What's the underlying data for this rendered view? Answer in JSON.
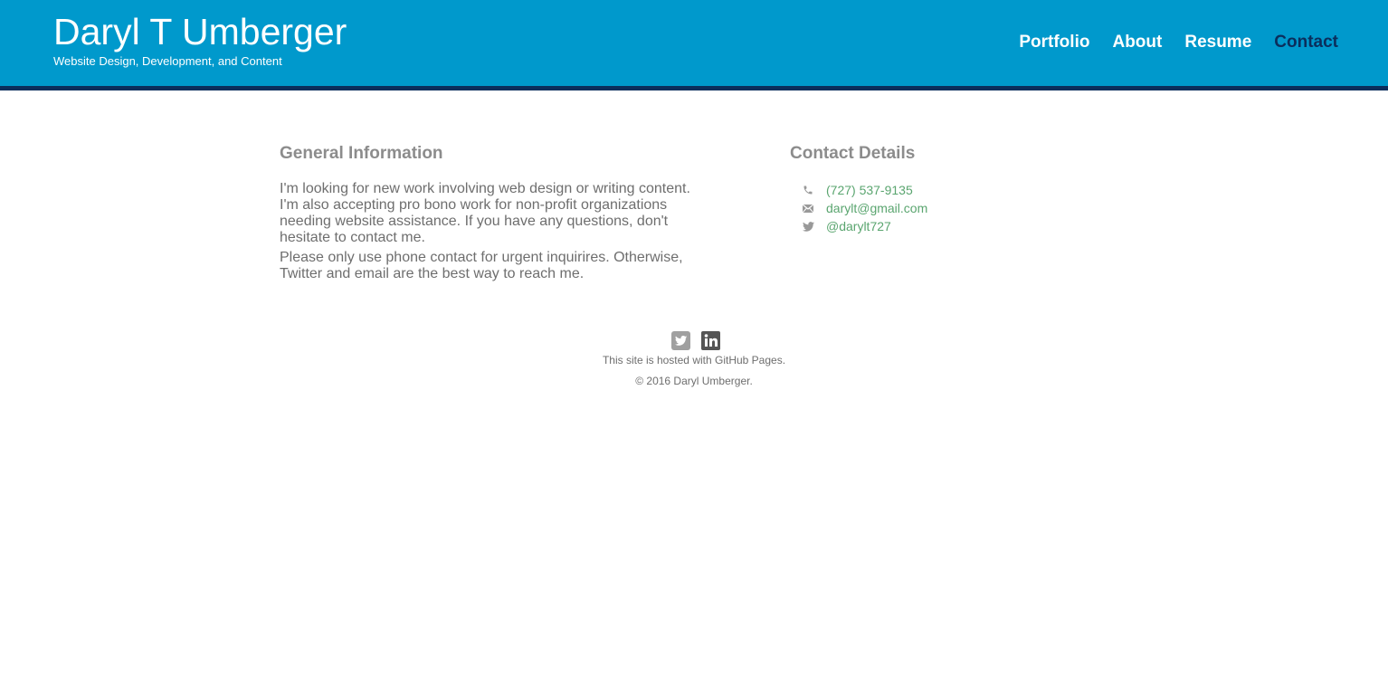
{
  "header": {
    "title": "Daryl T Umberger",
    "tagline": "Website Design, Development, and Content",
    "nav": [
      {
        "label": "Portfolio"
      },
      {
        "label": "About"
      },
      {
        "label": "Resume"
      },
      {
        "label": "Contact",
        "active": true
      }
    ]
  },
  "general": {
    "title": "General Information",
    "paragraphs": [
      "I'm looking for new work involving web design or writing content. I'm also accepting pro bono work for non-profit organizations needing website assistance. If you have any questions, don't hesitate to contact me.",
      "Please only use phone contact for urgent inquirires. Otherwise, Twitter and email are the best way to reach me."
    ]
  },
  "contact": {
    "title": "Contact Details",
    "items": [
      {
        "icon": "phone-icon",
        "value": "(727) 537-9135"
      },
      {
        "icon": "mail-icon",
        "value": "darylt@gmail.com"
      },
      {
        "icon": "twitter-icon",
        "value": "@darylt727"
      }
    ]
  },
  "footer": {
    "social": [
      {
        "icon": "twitter-icon"
      },
      {
        "icon": "linkedin-icon"
      }
    ],
    "hosted_prefix": "This site is hosted with ",
    "hosted_link": "GitHub Pages",
    "hosted_suffix": ".",
    "copyright": "© 2016 Daryl Umberger."
  },
  "colors": {
    "header_bg": "#0099cc",
    "header_border": "#0b2e5c",
    "nav_active": "#0b2e5c",
    "heading": "#8c8c8c",
    "body_text": "#6e6e6e",
    "link": "#5aa56f"
  }
}
